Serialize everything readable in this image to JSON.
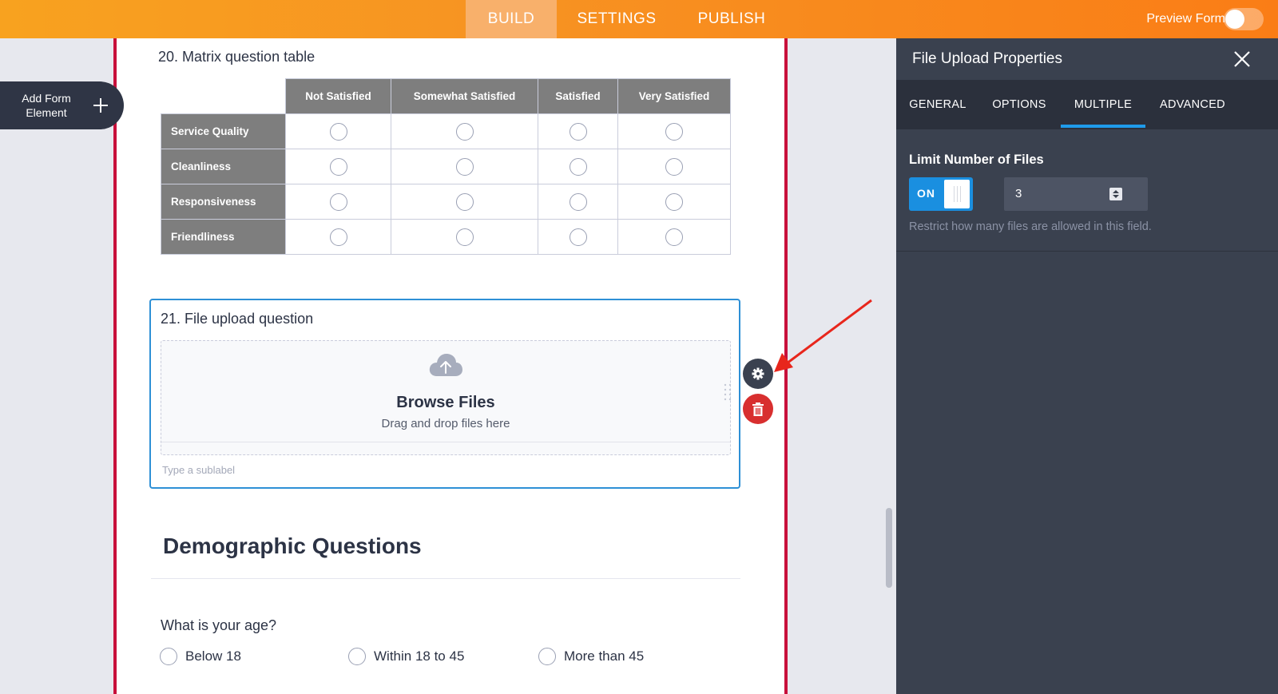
{
  "topbar": {
    "tabs": [
      {
        "label": "BUILD",
        "active": true
      },
      {
        "label": "SETTINGS",
        "active": false
      },
      {
        "label": "PUBLISH",
        "active": false
      }
    ],
    "preview_label": "Preview Form",
    "preview_enabled": false,
    "accent_color": "#f79322"
  },
  "add_element": {
    "label": "Add Form Element",
    "line1": "Add Form",
    "line2": "Element",
    "icon": "plus-icon"
  },
  "matrix": {
    "title": "20. Matrix question table",
    "columns": [
      "Not Satisfied",
      "Somewhat Satisfied",
      "Satisfied",
      "Very Satisfied"
    ],
    "rows": [
      "Service Quality",
      "Cleanliness",
      "Responsiveness",
      "Friendliness"
    ]
  },
  "upload": {
    "title": "21. File upload question",
    "browse_label": "Browse Files",
    "drag_text": "Drag and drop files here",
    "sublabel_placeholder": "Type a sublabel",
    "icon": "cloud-upload-icon"
  },
  "field_actions": {
    "settings_icon": "gear-icon",
    "delete_icon": "trash-icon"
  },
  "demographics": {
    "heading": "Demographic Questions",
    "age_question": "What is your age?",
    "age_options": [
      "Below 18",
      "Within 18 to 45",
      "More than 45"
    ]
  },
  "panel": {
    "title": "File Upload Properties",
    "tabs": [
      {
        "label": "GENERAL",
        "active": false
      },
      {
        "label": "OPTIONS",
        "active": false
      },
      {
        "label": "MULTIPLE",
        "active": true
      },
      {
        "label": "ADVANCED",
        "active": false
      }
    ],
    "limit_label": "Limit Number of Files",
    "toggle_label": "ON",
    "limit_value": "3",
    "hint": "Restrict how many files are allowed in this field.",
    "accent_color": "#1a8fe0"
  }
}
